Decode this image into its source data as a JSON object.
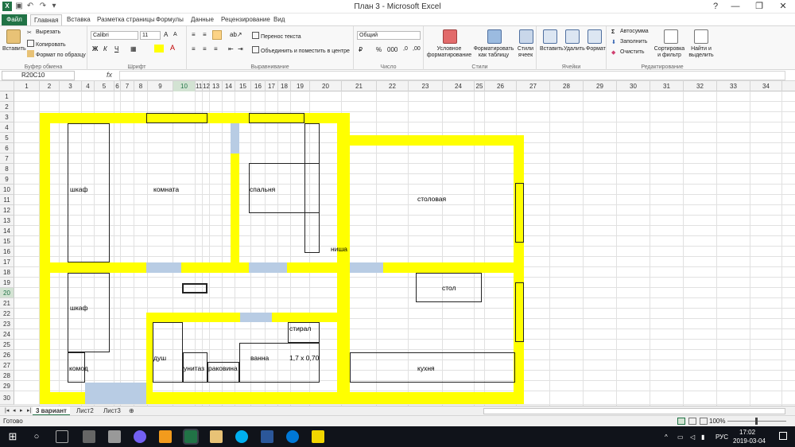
{
  "window": {
    "title": "План 3 - Microsoft Excel"
  },
  "tabs": {
    "file": "Файл",
    "items": [
      "Главная",
      "Вставка",
      "Разметка страницы",
      "Формулы",
      "Данные",
      "Рецензирование",
      "Вид"
    ]
  },
  "ribbon": {
    "clipboard": {
      "paste": "Вставить",
      "cut": "Вырезать",
      "copy": "Копировать",
      "format_painter": "Формат по образцу",
      "label": "Буфер обмена"
    },
    "font": {
      "name": "Calibri",
      "size": "11",
      "label": "Шрифт"
    },
    "alignment": {
      "wrap": "Перенос текста",
      "merge": "Объединить и поместить в центре",
      "label": "Выравнивание"
    },
    "number": {
      "format": "Общий",
      "label": "Число"
    },
    "styles": {
      "conditional": "Условное форматирование",
      "as_table": "Форматировать как таблицу",
      "cell_styles": "Стили ячеек",
      "label": "Стили"
    },
    "cells": {
      "insert": "Вставить",
      "delete": "Удалить",
      "format": "Формат",
      "label": "Ячейки"
    },
    "editing": {
      "autosum": "Автосумма",
      "fill": "Заполнить",
      "clear": "Очистить",
      "sort": "Сортировка и фильтр",
      "find": "Найти и выделить",
      "label": "Редактирование"
    }
  },
  "formula_bar": {
    "name_box": "R20C10",
    "fx": "fx",
    "value": ""
  },
  "columns": [
    "1",
    "2",
    "3",
    "4",
    "5",
    "6",
    "7",
    "8",
    "9",
    "10",
    "11",
    "12",
    "13",
    "14",
    "15",
    "16",
    "17",
    "18",
    "19",
    "20",
    "21",
    "22",
    "23",
    "24",
    "25",
    "26",
    "27",
    "28",
    "29",
    "30",
    "31",
    "32",
    "33",
    "34"
  ],
  "rows": [
    "1",
    "2",
    "3",
    "4",
    "5",
    "6",
    "7",
    "8",
    "9",
    "10",
    "11",
    "12",
    "13",
    "14",
    "15",
    "16",
    "17",
    "18",
    "19",
    "20",
    "21",
    "22",
    "23",
    "24",
    "25",
    "26",
    "27",
    "28",
    "29",
    "30"
  ],
  "plan_labels": {
    "wardrobe1": "шкаф",
    "room": "комната",
    "bedroom": "спальня",
    "dining": "столовая",
    "niche": "ниша",
    "wardrobe2": "шкаф",
    "table": "стол",
    "washer": "стирал",
    "shower": "душ",
    "toilet": "унитаз",
    "sink": "раковина",
    "bath": "ванна",
    "bath_size": "1,7 х 0,70",
    "dresser": "комод",
    "kitchen": "кухня"
  },
  "sheet_tabs": [
    "3 вариант",
    "Лист2",
    "Лист3"
  ],
  "status": {
    "ready": "Готово",
    "zoom": "100%"
  },
  "taskbar": {
    "lang": "РУС",
    "time": "17:02",
    "date": "2019-03-04"
  },
  "colors": {
    "plan_fill": "#ffff00",
    "window_fill": "#b8cce4",
    "excel_green": "#217346"
  }
}
